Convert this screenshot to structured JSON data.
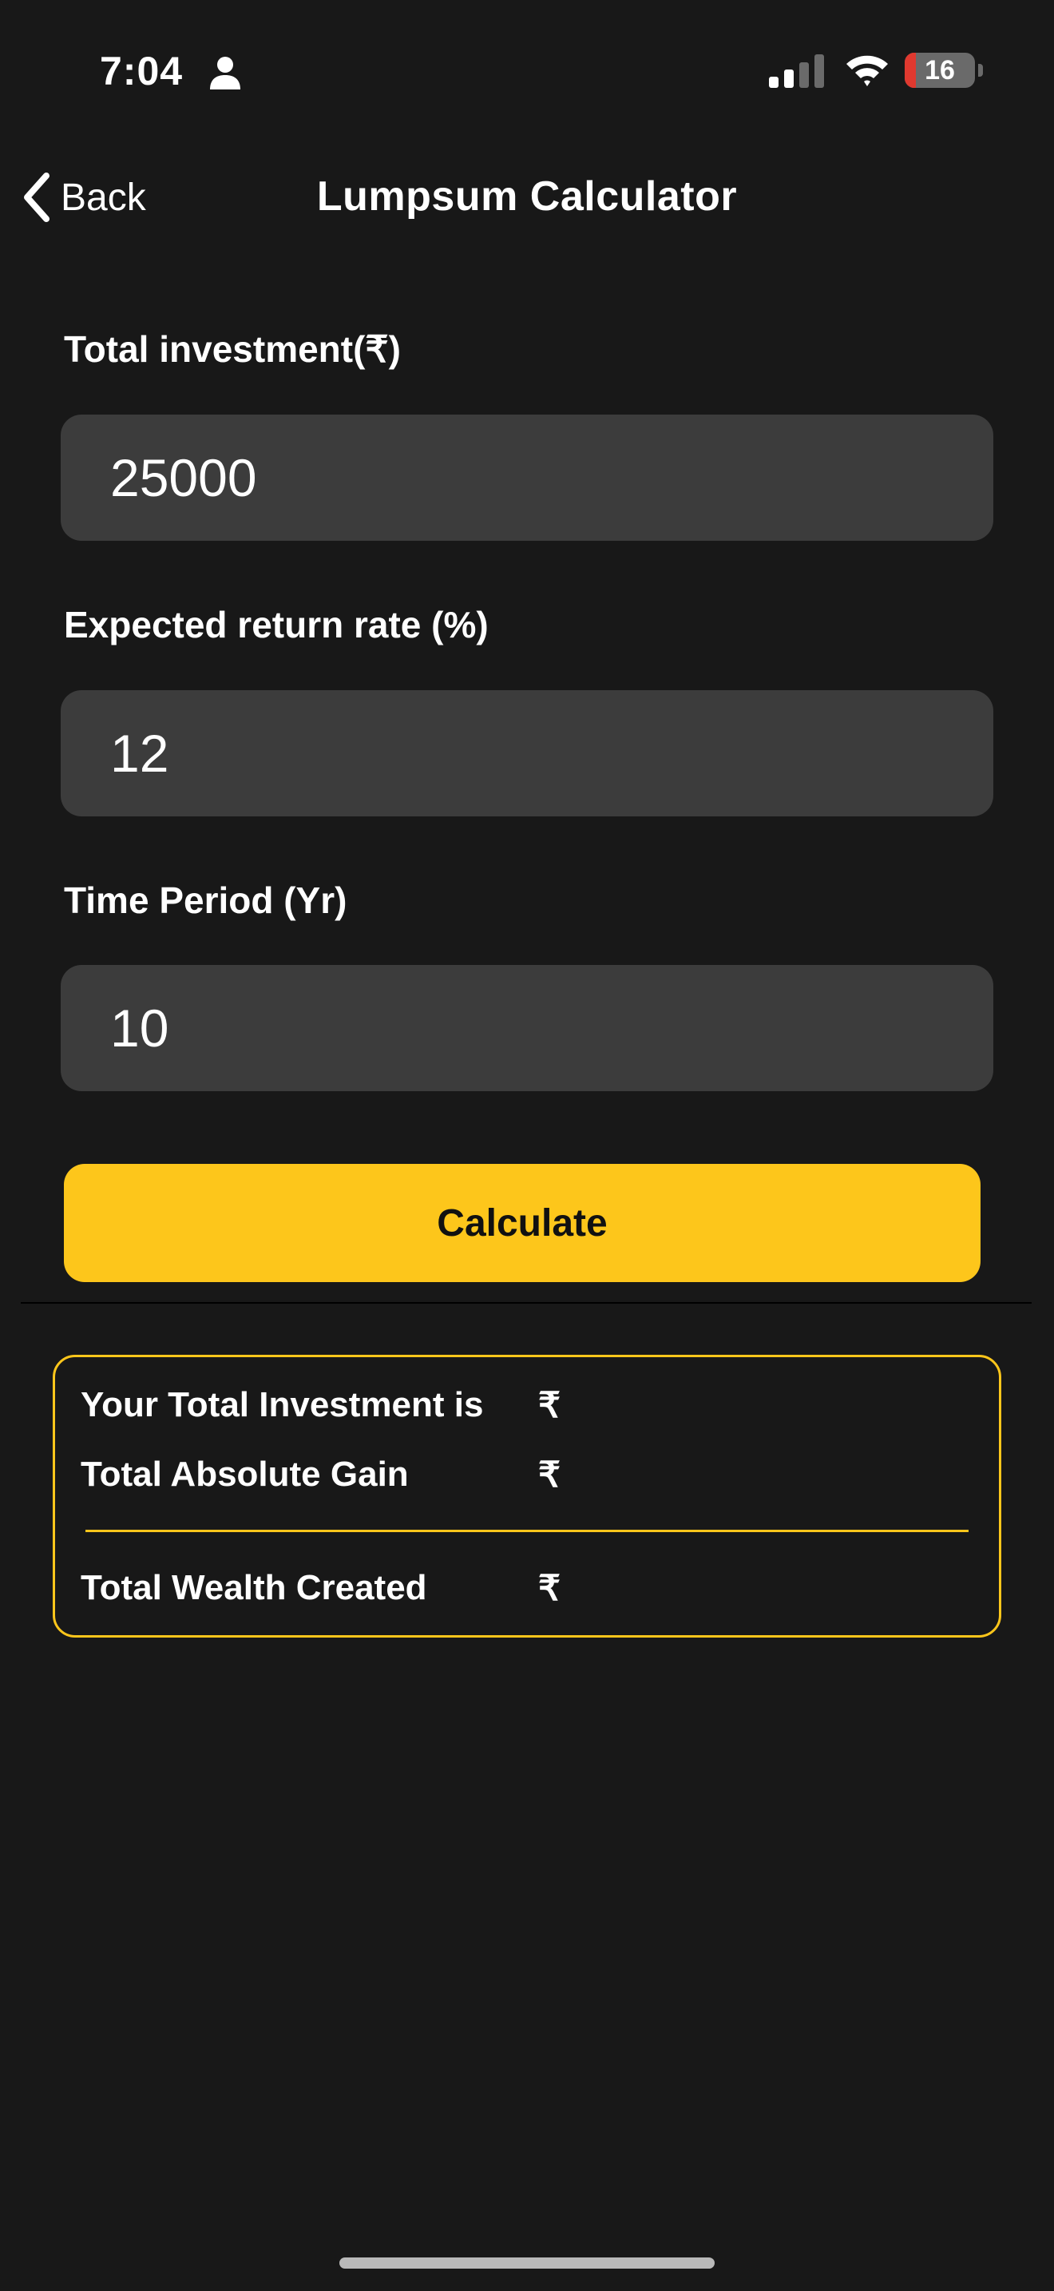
{
  "status_bar": {
    "time": "7:04",
    "battery_level": "16",
    "battery_fraction": 0.16,
    "signal_bars_active": 2,
    "signal_bars_total": 4
  },
  "nav": {
    "back_label": "Back",
    "title": "Lumpsum Calculator"
  },
  "form": {
    "investment_label": "Total investment(₹)",
    "investment_value": "25000",
    "return_rate_label": "Expected return rate (%)",
    "return_rate_value": "12",
    "time_period_label": "Time Period (Yr)",
    "time_period_value": "10",
    "calculate_label": "Calculate"
  },
  "results": {
    "total_investment_label": "Your Total Investment is",
    "total_investment_value": "₹",
    "absolute_gain_label": "Total Absolute Gain",
    "absolute_gain_value": "₹",
    "wealth_created_label": "Total Wealth Created",
    "wealth_created_value": "₹"
  },
  "colors": {
    "background": "#181818",
    "input_background": "#3c3c3c",
    "accent": "#fdc61b",
    "battery_low": "#e0392f"
  }
}
